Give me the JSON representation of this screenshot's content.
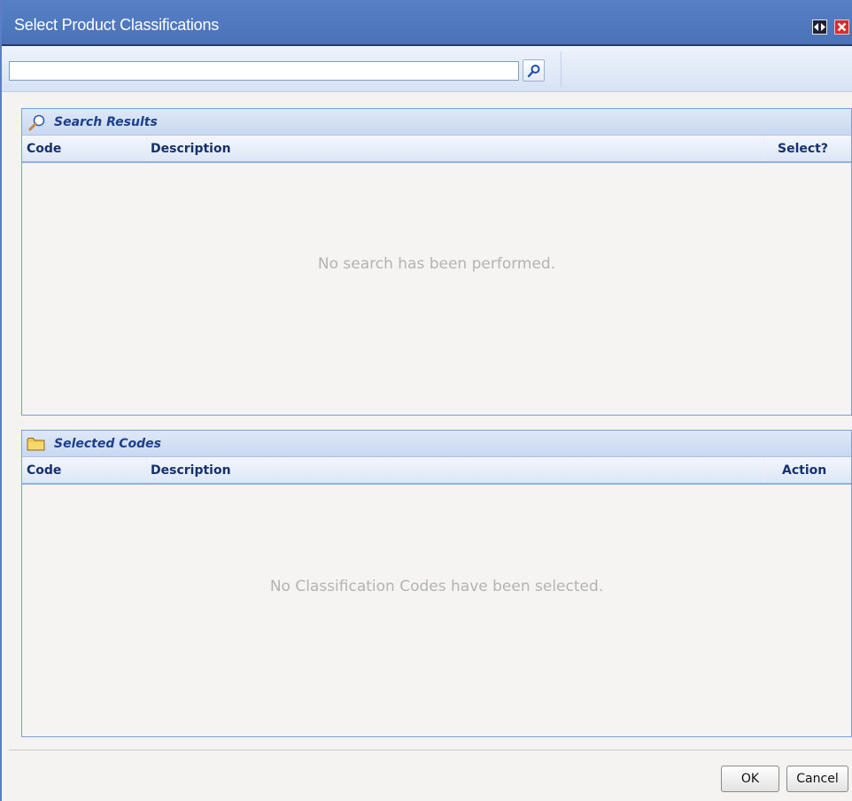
{
  "dialog": {
    "title": "Select Product Classifications",
    "title_buttons": [
      {
        "name": "resize-icon"
      },
      {
        "name": "close-icon"
      }
    ]
  },
  "toolbar": {
    "search_value": "",
    "search_placeholder": "",
    "search_icon": "magnifier-icon"
  },
  "search_results": {
    "title": "Search Results",
    "icon": "magnifier-icon",
    "columns": {
      "code": "Code",
      "description": "Description",
      "select": "Select?"
    },
    "empty_message": "No search has been performed."
  },
  "selected_codes": {
    "title": "Selected Codes",
    "icon": "folder-icon",
    "columns": {
      "code": "Code",
      "description": "Description",
      "action": "Action"
    },
    "empty_message": "No Classification Codes have been selected."
  },
  "footer": {
    "ok_label": "OK",
    "cancel_label": "Cancel"
  },
  "colors": {
    "titlebar": "#4f78bf",
    "panel_border": "#7a9fd8",
    "header_text": "#1b3f8c",
    "close_button": "#d92b2b"
  }
}
